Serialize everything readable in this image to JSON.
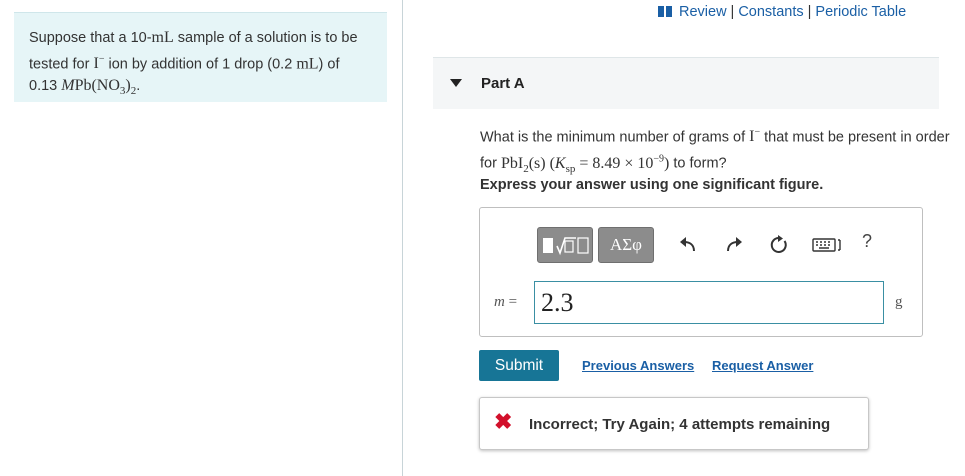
{
  "problem": {
    "line1": "Suppose that a 10-",
    "line1_unit": "mL",
    "line1_end": " sample of a solution is to be",
    "line2_start": "tested for ",
    "line2_ion": "I",
    "line2_mid": " ion by addition of 1 drop (0.2 ",
    "line2_unit": "mL",
    "line2_end": ") of",
    "line3_start": "0.13 ",
    "line3_M": "M",
    "line3_formula": "Pb(NO",
    "line3_sub": "3",
    "line3_close": ")",
    "line3_sub2": "2",
    "line3_end": "."
  },
  "nav": {
    "review": "Review",
    "constants": "Constants",
    "periodic_table": "Periodic Table",
    "separator": "|"
  },
  "part": {
    "title": "Part A"
  },
  "question": {
    "text1": "What is the minimum number of grams of ",
    "ion": "I",
    "text2": " that must be present in order for ",
    "compound": "PbI",
    "compound_sub": "2",
    "state": "(s)",
    "ksp_open": " (",
    "ksp_K": "K",
    "ksp_sub": "sp",
    "ksp_value": " = 8.49 × 10",
    "ksp_exp": "−9",
    "ksp_close": ")",
    "text3": " to form?"
  },
  "instruction": "Express your answer using one significant figure.",
  "toolbar": {
    "symbols_label": "ΑΣφ",
    "help_label": "?",
    "icons": [
      "templates-icon",
      "undo-icon",
      "redo-icon",
      "reset-icon",
      "keyboard-icon",
      "help-icon"
    ]
  },
  "answer": {
    "variable": "m",
    "equals": " =",
    "value": "2.3",
    "unit": "g"
  },
  "actions": {
    "submit": "Submit",
    "previous_answers": "Previous Answers",
    "request_answer": "Request Answer"
  },
  "feedback": {
    "text": "Incorrect; Try Again; 4 attempts remaining",
    "color": "#d2102b"
  },
  "colors": {
    "accent": "#177596",
    "link": "#1a5fa5",
    "problem_bg": "#e6f5f7"
  }
}
